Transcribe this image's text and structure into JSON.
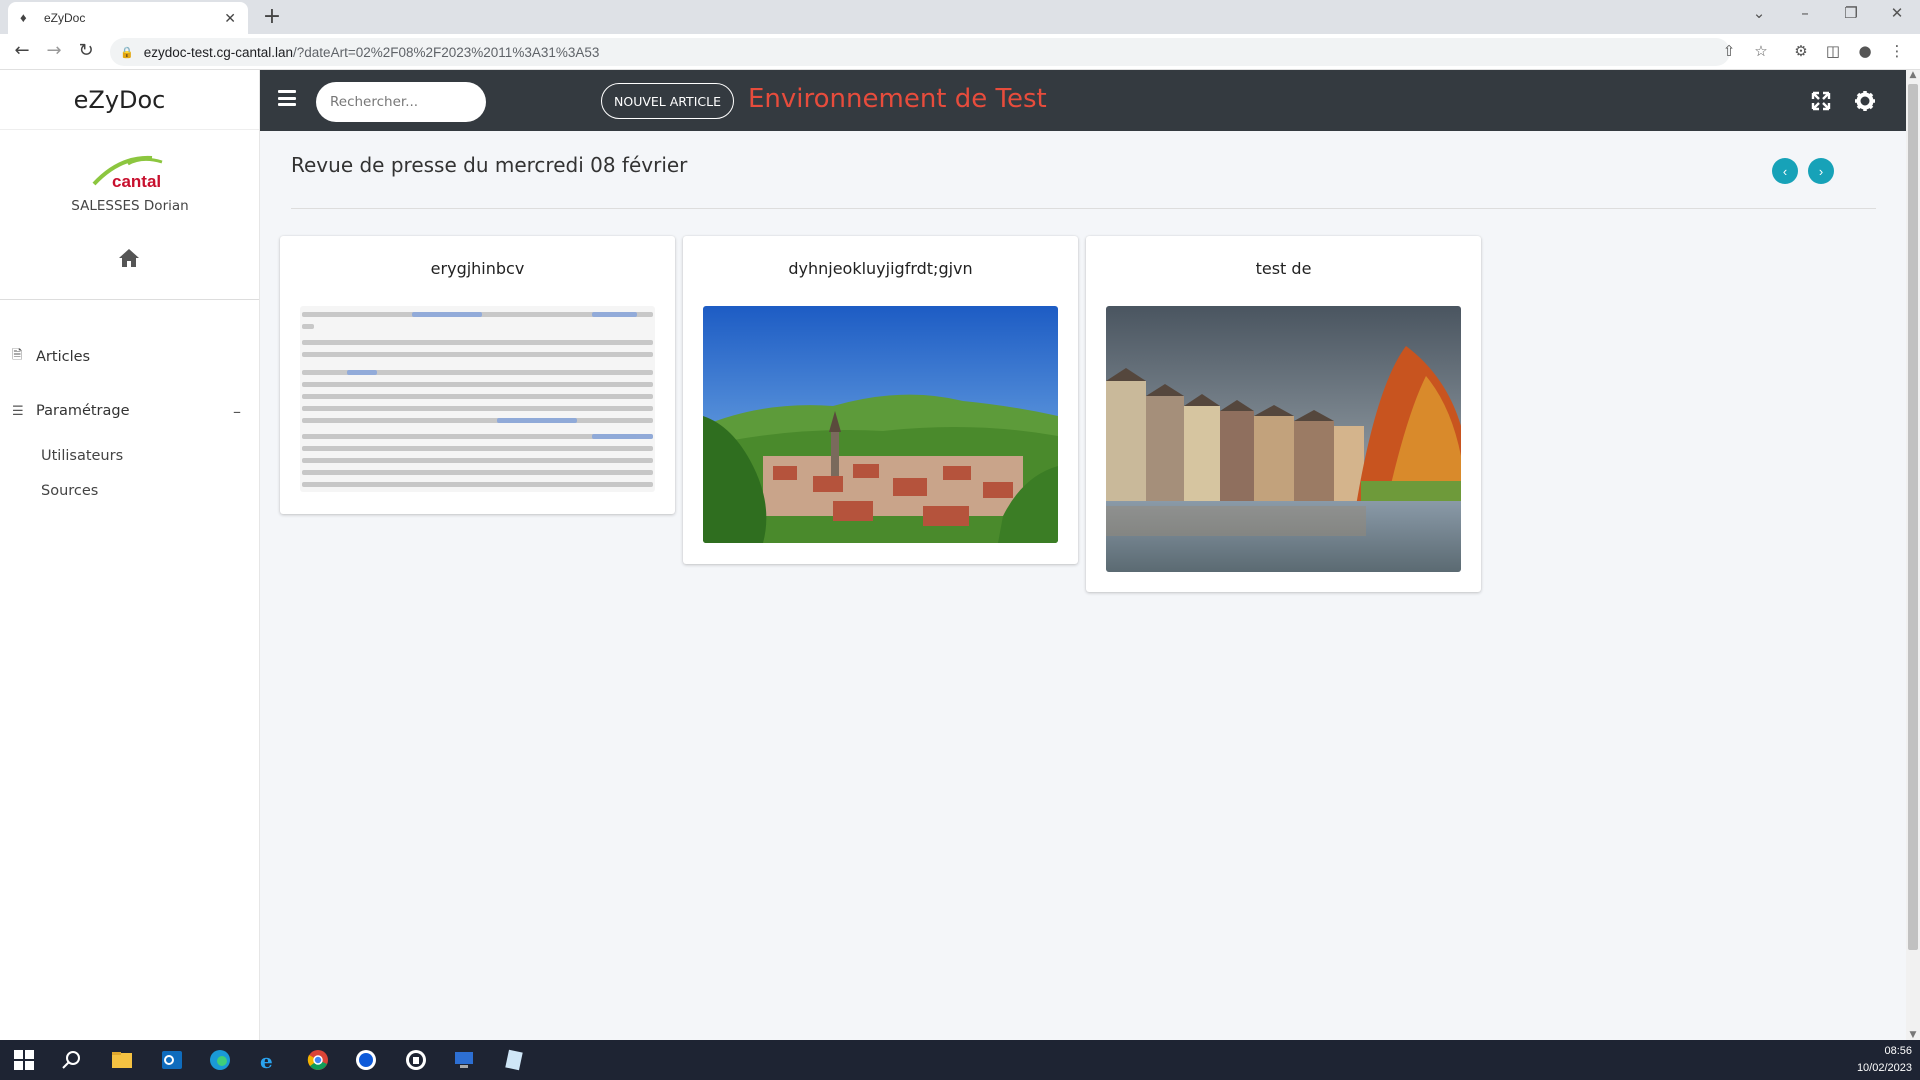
{
  "browser": {
    "tab_title": "eZyDoc",
    "url_host": "ezydoc-test.cg-cantal.lan",
    "url_path": "/?dateArt=02%2F08%2F2023%2011%3A31%3A53"
  },
  "sidebar": {
    "brand": "eZyDoc",
    "logo_text": "cantal",
    "user_name": "SALESSES Dorian",
    "items": [
      {
        "label": "Articles"
      },
      {
        "label": "Paramétrage"
      }
    ],
    "sub_items": [
      {
        "label": "Utilisateurs"
      },
      {
        "label": "Sources"
      }
    ]
  },
  "topnav": {
    "search_placeholder": "Rechercher...",
    "new_article": "NOUVEL ARTICLE",
    "environment": "Environnement de Test"
  },
  "main": {
    "title": "Revue de presse du mercredi 08 février",
    "cards": [
      {
        "title": "erygjhinbcv",
        "image": "blurred-text"
      },
      {
        "title": "dyhnjeokluyjigfrdt;gjvn",
        "image": "village-landscape"
      },
      {
        "title": "test de",
        "image": "river-town"
      }
    ]
  },
  "taskbar": {
    "time": "08:56",
    "date": "10/02/2023"
  },
  "colors": {
    "topnav_bg": "#343a40",
    "env_text": "#e74c3c",
    "accent": "#17a2b8"
  }
}
